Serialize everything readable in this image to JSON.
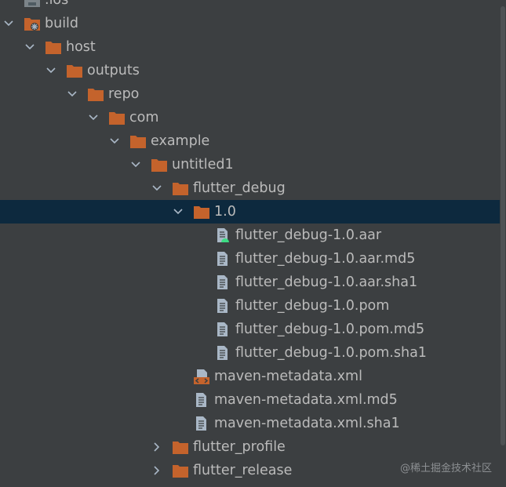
{
  "tree": {
    "items": [
      {
        "label": ".ios",
        "type": "folder-ios"
      },
      {
        "label": "build",
        "type": "folder-build",
        "expanded": true
      },
      {
        "label": "host",
        "type": "folder",
        "expanded": true
      },
      {
        "label": "outputs",
        "type": "folder",
        "expanded": true
      },
      {
        "label": "repo",
        "type": "folder",
        "expanded": true
      },
      {
        "label": "com",
        "type": "folder",
        "expanded": true
      },
      {
        "label": "example",
        "type": "folder",
        "expanded": true
      },
      {
        "label": "untitled1",
        "type": "folder",
        "expanded": true
      },
      {
        "label": "flutter_debug",
        "type": "folder",
        "expanded": true
      },
      {
        "label": "1.0",
        "type": "folder",
        "expanded": true,
        "selected": true
      },
      {
        "label": "flutter_debug-1.0.aar",
        "type": "aar"
      },
      {
        "label": "flutter_debug-1.0.aar.md5",
        "type": "file"
      },
      {
        "label": "flutter_debug-1.0.aar.sha1",
        "type": "file"
      },
      {
        "label": "flutter_debug-1.0.pom",
        "type": "file"
      },
      {
        "label": "flutter_debug-1.0.pom.md5",
        "type": "file"
      },
      {
        "label": "flutter_debug-1.0.pom.sha1",
        "type": "file"
      },
      {
        "label": "maven-metadata.xml",
        "type": "xml"
      },
      {
        "label": "maven-metadata.xml.md5",
        "type": "file"
      },
      {
        "label": "maven-metadata.xml.sha1",
        "type": "file"
      },
      {
        "label": "flutter_profile",
        "type": "folder",
        "expanded": false
      },
      {
        "label": "flutter_release",
        "type": "folder",
        "expanded": false
      }
    ]
  },
  "watermark": "@稀土掘金技术社区",
  "colors": {
    "background": "#3c3f41",
    "selected": "#0d293e",
    "folder": "#c4632c",
    "text": "#bbbbbb",
    "file_icon": "#a9b7c6",
    "android_green": "#3ddc84"
  }
}
